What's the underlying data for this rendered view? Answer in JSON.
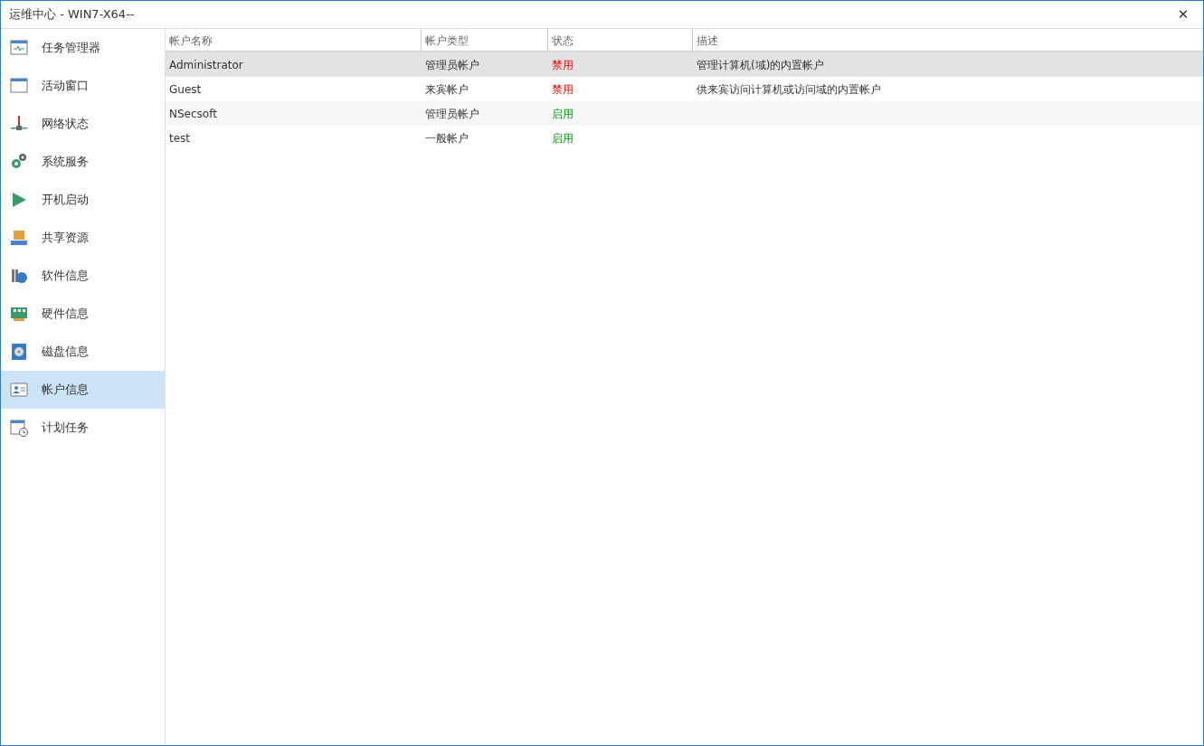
{
  "window": {
    "title": "运维中心 - WIN7-X64--",
    "close": "✕"
  },
  "sidebar": {
    "items": [
      {
        "label": "任务管理器",
        "selected": false
      },
      {
        "label": "活动窗口",
        "selected": false
      },
      {
        "label": "网络状态",
        "selected": false
      },
      {
        "label": "系统服务",
        "selected": false
      },
      {
        "label": "开机启动",
        "selected": false
      },
      {
        "label": "共享资源",
        "selected": false
      },
      {
        "label": "软件信息",
        "selected": false
      },
      {
        "label": "硬件信息",
        "selected": false
      },
      {
        "label": "磁盘信息",
        "selected": false
      },
      {
        "label": "帐户信息",
        "selected": true
      },
      {
        "label": "计划任务",
        "selected": false
      }
    ]
  },
  "table": {
    "columns": [
      "帐户名称",
      "帐户类型",
      "状态",
      "描述"
    ],
    "rows": [
      {
        "name": "Administrator",
        "type": "管理员帐户",
        "status": "禁用",
        "enabled": false,
        "description": "管理计算机(域)的内置帐户",
        "selected": true
      },
      {
        "name": "Guest",
        "type": "来宾帐户",
        "status": "禁用",
        "enabled": false,
        "description": "供来宾访问计算机或访问域的内置帐户",
        "selected": false
      },
      {
        "name": "NSecsoft",
        "type": "管理员帐户",
        "status": "启用",
        "enabled": true,
        "selected": false
      },
      {
        "name": "test",
        "type": "一般帐户",
        "status": "启用",
        "enabled": true,
        "selected": false
      }
    ]
  }
}
